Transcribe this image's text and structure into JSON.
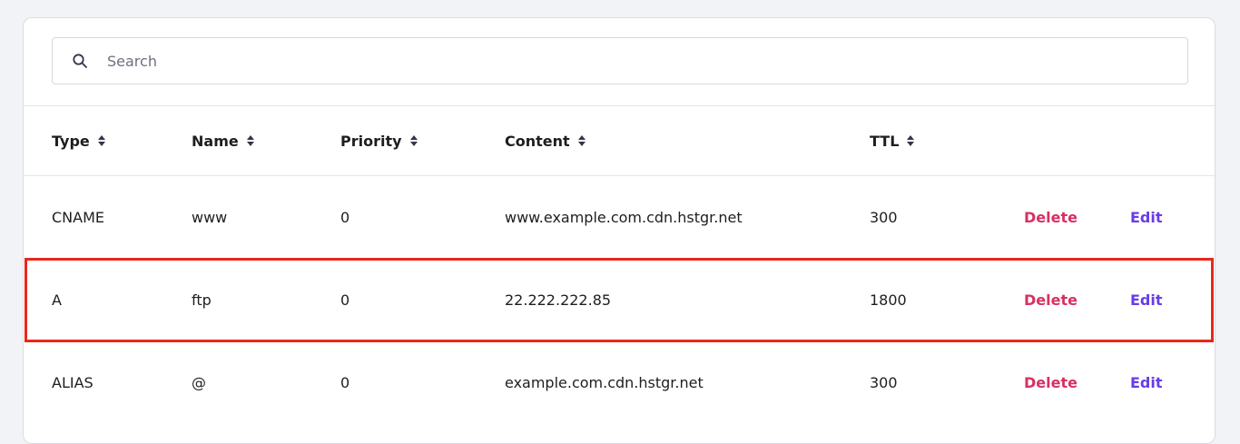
{
  "search": {
    "placeholder": "Search",
    "icon": "search-icon"
  },
  "table": {
    "columns": [
      {
        "key": "type",
        "label": "Type"
      },
      {
        "key": "name",
        "label": "Name"
      },
      {
        "key": "priority",
        "label": "Priority"
      },
      {
        "key": "content",
        "label": "Content"
      },
      {
        "key": "ttl",
        "label": "TTL"
      }
    ],
    "rows": [
      {
        "type": "CNAME",
        "name": "www",
        "priority": "0",
        "content": "www.example.com.cdn.hstgr.net",
        "ttl": "300",
        "delete_label": "Delete",
        "edit_label": "Edit"
      },
      {
        "type": "A",
        "name": "ftp",
        "priority": "0",
        "content": "22.222.222.85",
        "ttl": "1800",
        "delete_label": "Delete",
        "edit_label": "Edit"
      },
      {
        "type": "ALIAS",
        "name": "@",
        "priority": "0",
        "content": "example.com.cdn.hstgr.net",
        "ttl": "300",
        "delete_label": "Delete",
        "edit_label": "Edit"
      }
    ],
    "highlighted_row": 1
  },
  "colors": {
    "delete": "#d63163",
    "edit": "#673de6",
    "highlight": "#e8271c",
    "background": "#f2f3f6"
  }
}
